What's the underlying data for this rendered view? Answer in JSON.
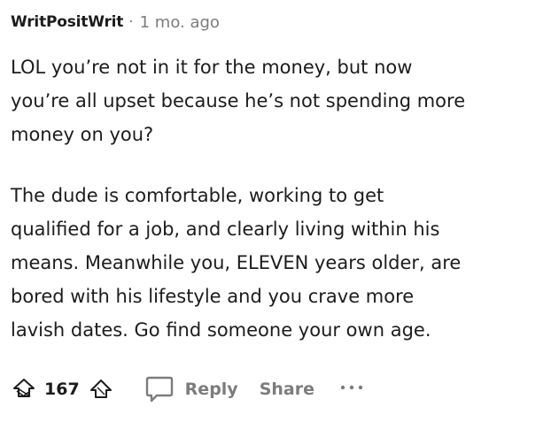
{
  "comment": {
    "username": "WritPositWrit",
    "separator": "·",
    "time_ago": "1 mo. ago",
    "paragraph1": [
      "LOL you’re not in it for the money, but now",
      "you’re all upset because he’s not spending more",
      "money on you?"
    ],
    "paragraph2": [
      "The dude is comfortable, working to get",
      "qualified for a job, and clearly living within his",
      "means. Meanwhile you, ELEVEN years older, are",
      "bored with his lifestyle and you crave more",
      "lavish dates. Go find someone your own age."
    ]
  },
  "actions": {
    "score": "167",
    "reply_label": "Reply",
    "share_label": "Share",
    "upvote_icon": "upvote-icon",
    "downvote_icon": "downvote-icon",
    "reply_icon": "comment-bubble-icon",
    "more_icon": "ellipsis-icon"
  },
  "colors": {
    "text": "#1c1c1c",
    "muted": "#7c7c7c",
    "background": "#ffffff"
  }
}
